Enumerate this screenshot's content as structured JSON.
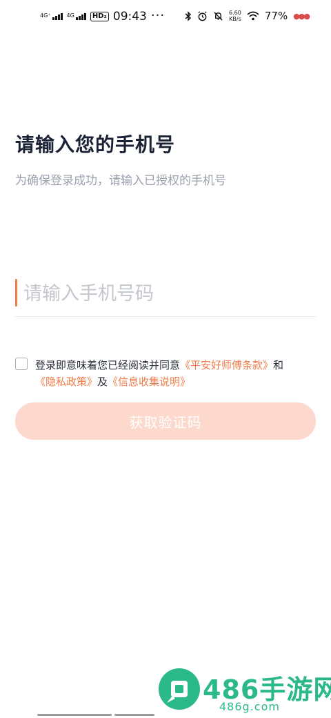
{
  "status_bar": {
    "net1": "4G⁺",
    "net2": "4G",
    "hd": "HD₂",
    "time": "09:43",
    "more": "···",
    "speed_value": "6.60",
    "speed_unit": "KB/s",
    "battery": "77%"
  },
  "page": {
    "title": "请输入您的手机号",
    "subtitle": "为确保登录成功，请输入已授权的手机号"
  },
  "phone": {
    "placeholder": "请输入手机号码",
    "value": ""
  },
  "agreement": {
    "checked": false,
    "prefix": "登录即意味着您已经阅读并同意",
    "terms": "《平安好师傅条款》",
    "and": "和",
    "privacy": "《隐私政策》",
    "ji": "及",
    "info": "《信息收集说明》"
  },
  "button": {
    "get_code": "获取验证码"
  },
  "watermark": {
    "brand": "486手游网",
    "domain": "486g.com"
  },
  "colors": {
    "accent": "#f07c4a",
    "button_disabled": "#fcd9cc",
    "title": "#1b2236",
    "subtitle": "#9aa1ad"
  }
}
